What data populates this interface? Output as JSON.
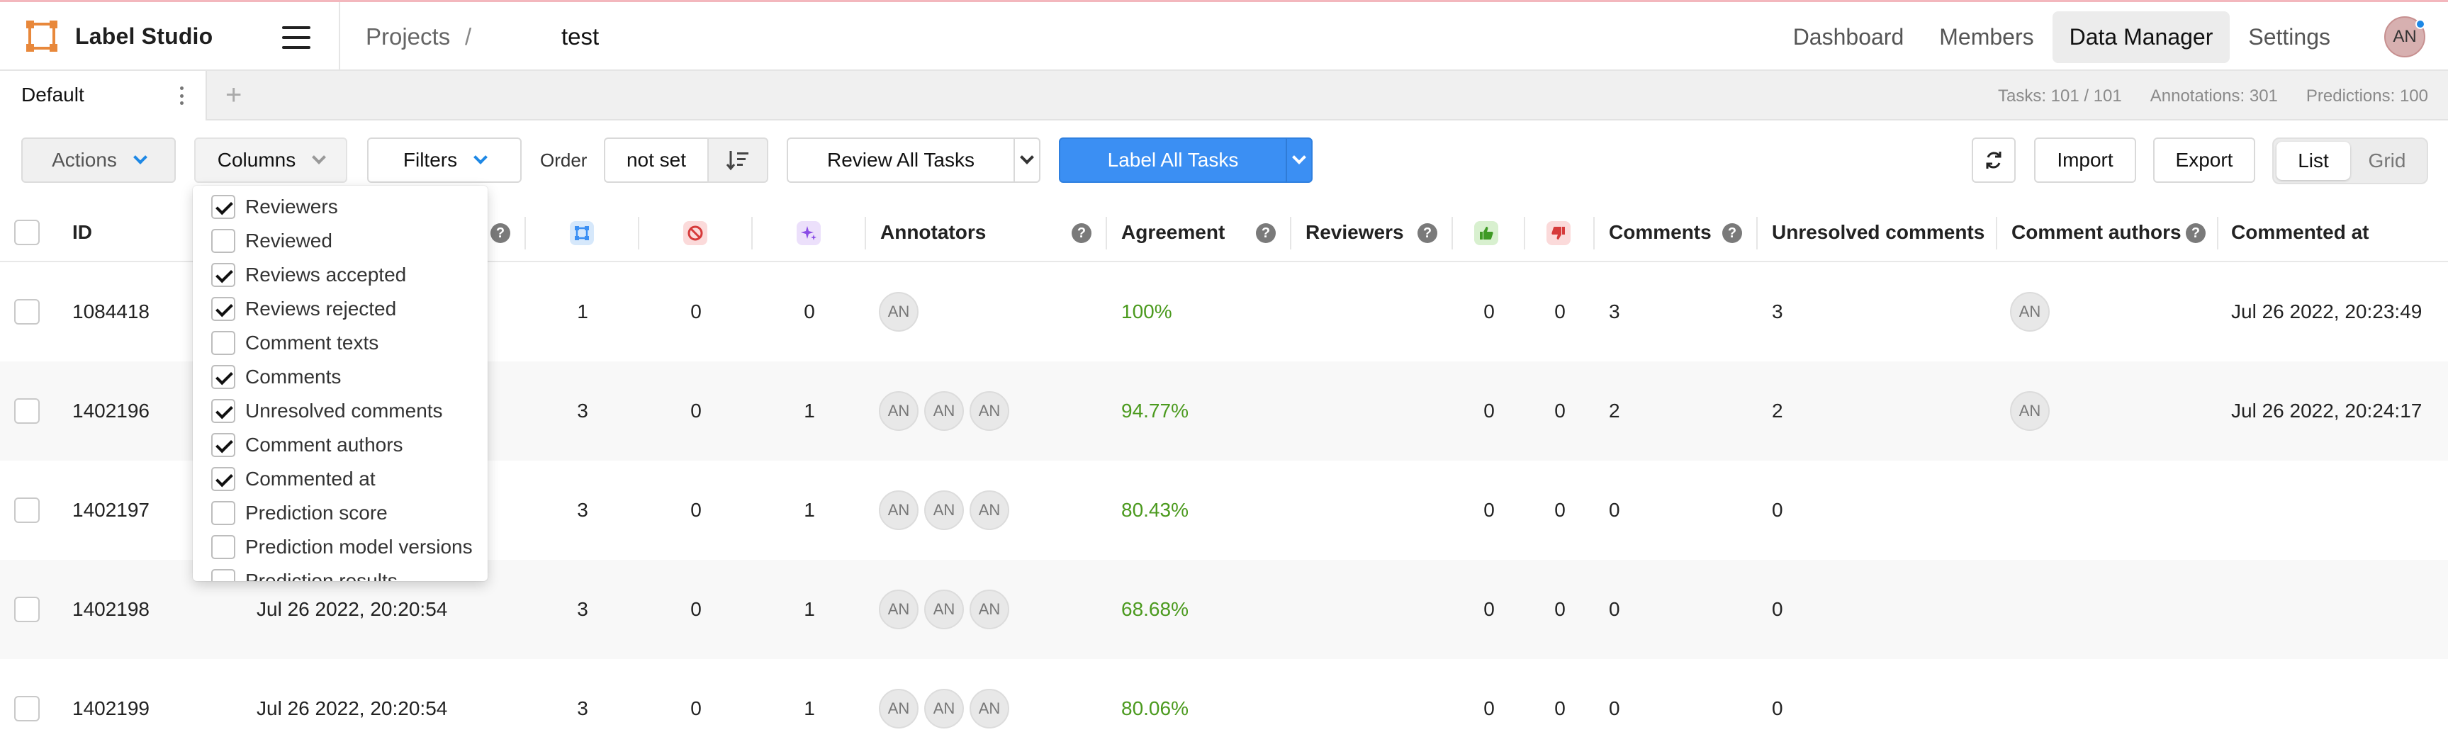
{
  "header": {
    "brand": "Label Studio",
    "breadcrumb_projects": "Projects",
    "breadcrumb_sep": "/",
    "breadcrumb_current": "test",
    "nav": [
      "Dashboard",
      "Members",
      "Data Manager",
      "Settings"
    ],
    "active_nav": "Data Manager",
    "avatar_initials": "AN"
  },
  "tabs": {
    "default_label": "Default",
    "add_label": "+",
    "stats": {
      "tasks": "Tasks: 101 / 101",
      "annotations": "Annotations: 301",
      "predictions": "Predictions: 100"
    }
  },
  "toolbar": {
    "actions": "Actions",
    "columns": "Columns",
    "filters": "Filters",
    "order_label": "Order",
    "order_value": "not set",
    "review_all": "Review All Tasks",
    "label_all": "Label All Tasks",
    "import": "Import",
    "export": "Export",
    "view_list": "List",
    "view_grid": "Grid"
  },
  "columns_menu": [
    {
      "label": "Reviewers",
      "checked": true
    },
    {
      "label": "Reviewed",
      "checked": false
    },
    {
      "label": "Reviews accepted",
      "checked": true
    },
    {
      "label": "Reviews rejected",
      "checked": true
    },
    {
      "label": "Comment texts",
      "checked": false
    },
    {
      "label": "Comments",
      "checked": true
    },
    {
      "label": "Unresolved comments",
      "checked": true
    },
    {
      "label": "Comment authors",
      "checked": true
    },
    {
      "label": "Commented at",
      "checked": true
    },
    {
      "label": "Prediction score",
      "checked": false
    },
    {
      "label": "Prediction model versions",
      "checked": false
    },
    {
      "label": "Prediction results",
      "checked": false
    }
  ],
  "table": {
    "headers": {
      "id": "ID",
      "annotators": "Annotators",
      "agreement": "Agreement",
      "reviewers": "Reviewers",
      "comments": "Comments",
      "unresolved": "Unresolved comments",
      "comment_authors": "Comment authors",
      "commented_at": "Commented at"
    },
    "rows": [
      {
        "id": "1084418",
        "completed": "",
        "total": "1",
        "cancelled": "0",
        "predictions": "0",
        "annotators": [
          "AN"
        ],
        "agreement": "100%",
        "accepted": "0",
        "rejected": "0",
        "comments": "3",
        "unresolved": "3",
        "authors": [
          "AN"
        ],
        "commented_at": "Jul 26 2022, 20:23:49"
      },
      {
        "id": "1402196",
        "completed": "",
        "total": "3",
        "cancelled": "0",
        "predictions": "1",
        "annotators": [
          "AN",
          "AN",
          "AN"
        ],
        "agreement": "94.77%",
        "accepted": "0",
        "rejected": "0",
        "comments": "2",
        "unresolved": "2",
        "authors": [
          "AN"
        ],
        "commented_at": "Jul 26 2022, 20:24:17"
      },
      {
        "id": "1402197",
        "completed": "",
        "total": "3",
        "cancelled": "0",
        "predictions": "1",
        "annotators": [
          "AN",
          "AN",
          "AN"
        ],
        "agreement": "80.43%",
        "accepted": "0",
        "rejected": "0",
        "comments": "0",
        "unresolved": "0",
        "authors": [],
        "commented_at": ""
      },
      {
        "id": "1402198",
        "completed": "Jul 26 2022, 20:20:54",
        "total": "3",
        "cancelled": "0",
        "predictions": "1",
        "annotators": [
          "AN",
          "AN",
          "AN"
        ],
        "agreement": "68.68%",
        "accepted": "0",
        "rejected": "0",
        "comments": "0",
        "unresolved": "0",
        "authors": [],
        "commented_at": ""
      },
      {
        "id": "1402199",
        "completed": "Jul 26 2022, 20:20:54",
        "total": "3",
        "cancelled": "0",
        "predictions": "1",
        "annotators": [
          "AN",
          "AN",
          "AN"
        ],
        "agreement": "80.06%",
        "accepted": "0",
        "rejected": "0",
        "comments": "0",
        "unresolved": "0",
        "authors": [],
        "commented_at": ""
      }
    ]
  },
  "colors": {
    "primary": "#3b8ff3",
    "agreement_green": "#4b9a1e",
    "total_icon_bg": "#d6e8fb",
    "cancelled_icon_bg": "#fbdada",
    "predictions_icon_bg": "#ece0fb",
    "accepted_icon_bg": "#d8f0cf",
    "rejected_icon_bg": "#fbdada"
  },
  "icons": {
    "total": "annotations-total-icon",
    "cancelled": "cancelled-icon",
    "predictions": "sparkle-icon",
    "accepted": "thumbs-up-icon",
    "rejected": "thumbs-down-icon",
    "help": "question-icon",
    "sort": "sort-icon",
    "refresh": "refresh-icon"
  }
}
